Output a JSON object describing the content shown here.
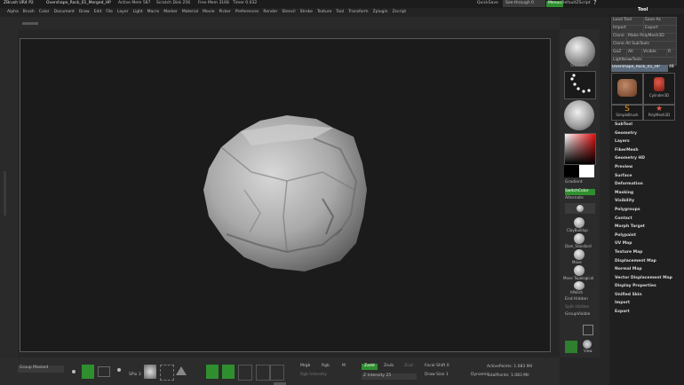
{
  "titlebar": {
    "app": "ZBrush UR4 P2",
    "doc": "Overshape_Rock_01_Merged_HP",
    "active_mem": "Active Mem 587",
    "scratch": "Scratch Disk 256",
    "free_mem": "Free Mem 3168",
    "timer": "Timer 0.032",
    "quicksave": "QuickSave",
    "seethrough": "See-through 0",
    "menus": "Menus",
    "script": "DefaultZScript"
  },
  "menubar": [
    "Alpha",
    "Brush",
    "Color",
    "Document",
    "Draw",
    "Edit",
    "File",
    "Layer",
    "Light",
    "Macro",
    "Marker",
    "Material",
    "Movie",
    "Picker",
    "Preferences",
    "Render",
    "Stencil",
    "Stroke",
    "Texture",
    "Tool",
    "Transform",
    "Zplugin",
    "Zscript"
  ],
  "rightshelf": {
    "brush_label": "Standard",
    "stroke_label": "Dots",
    "material_label": "MatCap",
    "gradient": "Gradient",
    "switchcolor": "SwitchColor",
    "alternate": "Alternate",
    "brushes": [
      "ClayBuildup",
      "Dam_Standard",
      "Move",
      "Move Topological",
      "hPolish"
    ],
    "end_hidden": "End Hidden",
    "split_hidden": "Split Hidden",
    "group_visible": "GroupVisible",
    "view": "View"
  },
  "tool_panel": {
    "title": "Tool",
    "load": "Load Tool",
    "save_as": "Save As",
    "import": "Import",
    "export": "Export",
    "clone": "Clone",
    "make_polymesh": "Make PolyMesh3D",
    "clone_all": "Clone All SubTools",
    "goz": "GoZ",
    "all": "All",
    "visible": "Visible",
    "r": "R",
    "lightbox": "Lightbox▸Tools",
    "current_tool": "Overshape_Rock_01_HP",
    "tool_count": "48",
    "thumbs": [
      "",
      "Cylinder3D",
      "SimpleBrush",
      "PolyMesh3D"
    ],
    "sections": [
      "SubTool",
      "Geometry",
      "Layers",
      "FiberMesh",
      "Geometry HD",
      "Preview",
      "Surface",
      "Deformation",
      "Masking",
      "Visibility",
      "Polygroups",
      "Contact",
      "Morph Target",
      "Polypaint",
      "UV Map",
      "Texture Map",
      "Displacement Map",
      "Normal Map",
      "Vector Displacement Map",
      "Display Properties",
      "Unified Skin",
      "Import",
      "Export"
    ]
  },
  "bottombar": {
    "group_masked": "Group Masked",
    "mrgb": "Mrgb",
    "rgb": "Rgb",
    "m": "M",
    "rgb_intensity": "Rgb Intensity",
    "zadd": "Zadd",
    "zsub": "Zsub",
    "zcut": "Zcut",
    "z_intensity": "Z Intensity 25",
    "focal_shift": "Focal Shift 0",
    "draw_size": "Draw Size 1",
    "dynamic": "Dynamic",
    "active_points": "ActivePoints: 1.083 Mil",
    "total_points": "TotalPoints: 1.083 Mil",
    "spix": "SPix 3",
    "lsym_buttons": [
      "Edit",
      "Draw",
      "Move",
      "Scale",
      "Rotate"
    ],
    "accent": "#3fae3f"
  }
}
